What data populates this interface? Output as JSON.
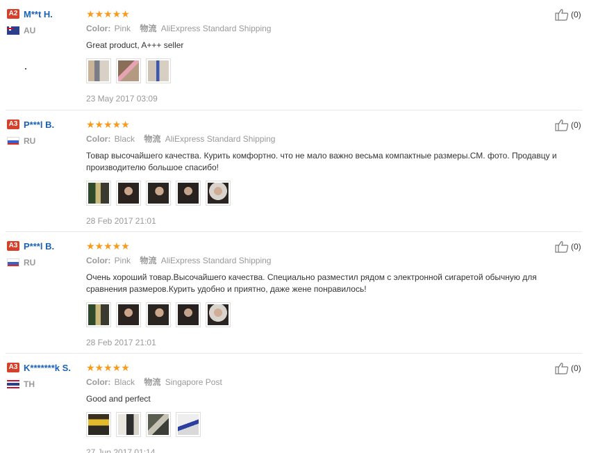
{
  "reviews": [
    {
      "level": "A2",
      "user": "M**t H.",
      "country": "AU",
      "stars": "★★★★★",
      "color_label": "Color:",
      "color": "Pink",
      "ship_label": "物流",
      "shipping": "AliExpress Standard Shipping",
      "text": "Great product, A+++ seller",
      "date": "23 May 2017 03:09",
      "likes": "(0)",
      "photo_count": 3
    },
    {
      "level": "A3",
      "user": "P***l B.",
      "country": "RU",
      "stars": "★★★★★",
      "color_label": "Color:",
      "color": "Black",
      "ship_label": "物流",
      "shipping": "AliExpress Standard Shipping",
      "text": "Товар высочайшего качества. Курить комфортно. что не мало важно весьма компактные размеры.СМ. фото. Продавцу и производителю большое спасибо!",
      "date": "28 Feb 2017 21:01",
      "likes": "(0)",
      "photo_count": 5
    },
    {
      "level": "A3",
      "user": "P***l B.",
      "country": "RU",
      "stars": "★★★★★",
      "color_label": "Color:",
      "color": "Pink",
      "ship_label": "物流",
      "shipping": "AliExpress Standard Shipping",
      "text": "Очень хороший товар.Высочайшего качества. Специально разместил рядом с электронной сигаретой обычную для сравнения размеров.Курить удобно и приятно, даже жене понравилось!",
      "date": "28 Feb 2017 21:01",
      "likes": "(0)",
      "photo_count": 5
    },
    {
      "level": "A3",
      "user": "K*******k S.",
      "country": "TH",
      "stars": "★★★★★",
      "color_label": "Color:",
      "color": "Black",
      "ship_label": "物流",
      "shipping": "Singapore Post",
      "text": "Good and perfect",
      "date": "27 Jun 2017 01:14",
      "likes": "(0)",
      "photo_count": 4
    }
  ],
  "colors": {
    "username": "#1a62b7",
    "badge": "#d6402a",
    "stars": "#f89b1c",
    "meta": "#999999"
  }
}
